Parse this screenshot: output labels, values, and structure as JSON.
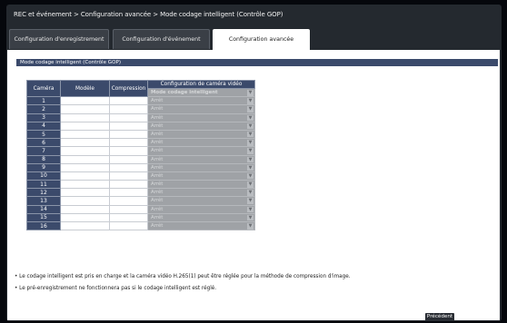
{
  "breadcrumb": "REC et événement > Configuration avancée > Mode codage intelligent (Contrôle GOP)",
  "tabs": [
    {
      "label": "Configuration d'enregistrement"
    },
    {
      "label": "Configuration d'événement"
    },
    {
      "label": "Configuration avancée"
    }
  ],
  "section_title": "Mode codage intelligent (Contrôle GOP)",
  "table": {
    "headers": {
      "camera": "Caméra",
      "model": "Modèle",
      "compression": "Compression",
      "video_config": "Configuration de caméra vidéo",
      "mode": "Mode codage intelligent"
    },
    "rows": [
      {
        "cam": "1",
        "model": "",
        "compression": "",
        "mode": "Arrêt"
      },
      {
        "cam": "2",
        "model": "",
        "compression": "",
        "mode": "Arrêt"
      },
      {
        "cam": "3",
        "model": "",
        "compression": "",
        "mode": "Arrêt"
      },
      {
        "cam": "4",
        "model": "",
        "compression": "",
        "mode": "Arrêt"
      },
      {
        "cam": "5",
        "model": "",
        "compression": "",
        "mode": "Arrêt"
      },
      {
        "cam": "6",
        "model": "",
        "compression": "",
        "mode": "Arrêt"
      },
      {
        "cam": "7",
        "model": "",
        "compression": "",
        "mode": "Arrêt"
      },
      {
        "cam": "8",
        "model": "",
        "compression": "",
        "mode": "Arrêt"
      },
      {
        "cam": "9",
        "model": "",
        "compression": "",
        "mode": "Arrêt"
      },
      {
        "cam": "10",
        "model": "",
        "compression": "",
        "mode": "Arrêt"
      },
      {
        "cam": "11",
        "model": "",
        "compression": "",
        "mode": "Arrêt"
      },
      {
        "cam": "12",
        "model": "",
        "compression": "",
        "mode": "Arrêt"
      },
      {
        "cam": "13",
        "model": "",
        "compression": "",
        "mode": "Arrêt"
      },
      {
        "cam": "14",
        "model": "",
        "compression": "",
        "mode": "Arrêt"
      },
      {
        "cam": "15",
        "model": "",
        "compression": "",
        "mode": "Arrêt"
      },
      {
        "cam": "16",
        "model": "",
        "compression": "",
        "mode": "Arrêt"
      }
    ]
  },
  "notes": [
    "• Le codage intelligent est pris en charge et la caméra vidéo H.265(1) peut être réglée pour la méthode de compression d'image.",
    "• Le pré-enregistrement ne fonctionnera pas si le codage intelligent est réglé."
  ],
  "buttons": {
    "previous": "Précédent"
  },
  "icons": {
    "dropdown": "chevron-down-icon"
  },
  "colors": {
    "header_bg": "#3b4a6b",
    "disabled_select": "#9fa2a6",
    "frame": "#24292f"
  }
}
